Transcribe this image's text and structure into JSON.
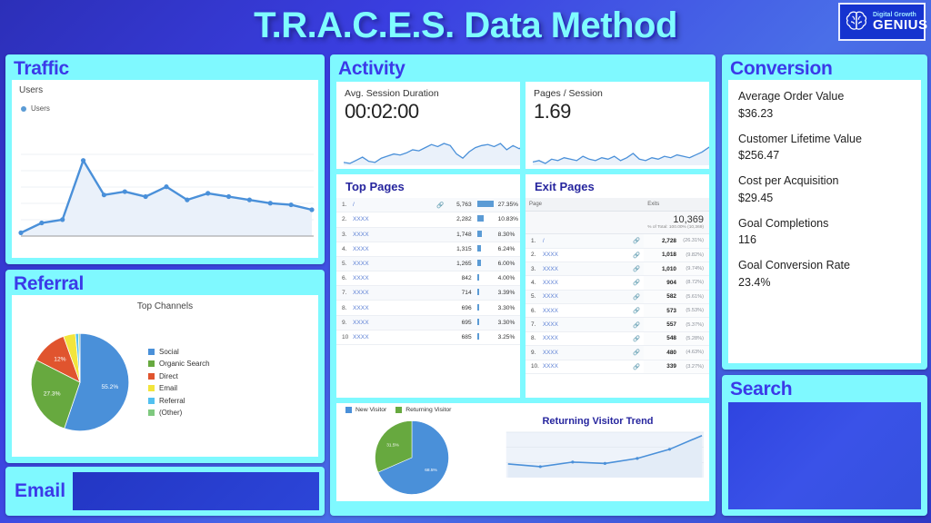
{
  "header": {
    "title": "T.R.A.C.E.S. Data Method",
    "logo": {
      "small": "Digital Growth",
      "big": "GENIUS",
      "icon": "brain-icon"
    }
  },
  "traffic": {
    "title": "Traffic",
    "chart_label": "Users",
    "legend": "Users",
    "chart_data": {
      "type": "line",
      "title": "Users",
      "xlabel": "",
      "ylabel": "Users",
      "legend": [
        "Users"
      ],
      "grid": true,
      "series": [
        {
          "name": "Users",
          "values": [
            2,
            8,
            10,
            46,
            25,
            27,
            24,
            30,
            22,
            26,
            24,
            22,
            20,
            19,
            16
          ]
        }
      ],
      "ylim": [
        0,
        50
      ]
    }
  },
  "referral": {
    "title": "Referral",
    "chart_data": {
      "type": "pie",
      "title": "Top Channels",
      "legend_position": "right",
      "categories": [
        "Social",
        "Organic Search",
        "Direct",
        "Email",
        "Referral",
        "(Other)"
      ],
      "values": [
        55.2,
        27.3,
        12.0,
        4.0,
        1.0,
        0.5
      ],
      "labels": [
        "55.2%",
        "27.3%",
        "12%",
        "",
        "",
        ""
      ],
      "colors": [
        "#4a90d9",
        "#67a93f",
        "#e0542e",
        "#f2e53c",
        "#52c0f0",
        "#7fc97f"
      ]
    }
  },
  "email": {
    "title": "Email"
  },
  "activity": {
    "title": "Activity",
    "kpis": [
      {
        "label": "Avg. Session Duration",
        "value": "00:02:00",
        "sparkline": "avg-session-duration-sparkline"
      },
      {
        "label": "Pages / Session",
        "value": "1.69",
        "sparkline": "pages-per-session-sparkline"
      }
    ],
    "top_pages": {
      "title": "Top Pages",
      "rows": [
        {
          "rank": "1.",
          "page": "/",
          "views": "5,763",
          "pct": "27.35%",
          "bar": 100
        },
        {
          "rank": "2.",
          "page": "XXXX",
          "views": "2,282",
          "pct": "10.83%",
          "bar": 40
        },
        {
          "rank": "3.",
          "page": "XXXX",
          "views": "1,748",
          "pct": "8.30%",
          "bar": 30
        },
        {
          "rank": "4.",
          "page": "XXXX",
          "views": "1,315",
          "pct": "6.24%",
          "bar": 23
        },
        {
          "rank": "5.",
          "page": "XXXX",
          "views": "1,265",
          "pct": "6.00%",
          "bar": 22
        },
        {
          "rank": "6.",
          "page": "XXXX",
          "views": "842",
          "pct": "4.00%",
          "bar": 15
        },
        {
          "rank": "7.",
          "page": "XXXX",
          "views": "714",
          "pct": "3.39%",
          "bar": 13
        },
        {
          "rank": "8.",
          "page": "XXXX",
          "views": "696",
          "pct": "3.30%",
          "bar": 12
        },
        {
          "rank": "9.",
          "page": "XXXX",
          "views": "695",
          "pct": "3.30%",
          "bar": 12
        },
        {
          "rank": "10",
          "page": "XXXX",
          "views": "685",
          "pct": "3.25%",
          "bar": 12
        }
      ]
    },
    "exit_pages": {
      "title": "Exit Pages",
      "col_page": "Page",
      "col_exits": "Exits",
      "total_value": "10,369",
      "total_sub": "% of Total: 100.00% (10,369)",
      "rows": [
        {
          "rank": "1.",
          "page": "/",
          "exits": "2,728",
          "pct": "(26.31%)"
        },
        {
          "rank": "2.",
          "page": "XXXX",
          "exits": "1,018",
          "pct": "(9.82%)"
        },
        {
          "rank": "3.",
          "page": "XXXX",
          "exits": "1,010",
          "pct": "(9.74%)"
        },
        {
          "rank": "4.",
          "page": "XXXX",
          "exits": "904",
          "pct": "(8.72%)"
        },
        {
          "rank": "5.",
          "page": "XXXX",
          "exits": "582",
          "pct": "(5.61%)"
        },
        {
          "rank": "6.",
          "page": "XXXX",
          "exits": "573",
          "pct": "(5.53%)"
        },
        {
          "rank": "7.",
          "page": "XXXX",
          "exits": "557",
          "pct": "(5.37%)"
        },
        {
          "rank": "8.",
          "page": "XXXX",
          "exits": "548",
          "pct": "(5.28%)"
        },
        {
          "rank": "9.",
          "page": "XXXX",
          "exits": "480",
          "pct": "(4.63%)"
        },
        {
          "rank": "10.",
          "page": "XXXX",
          "exits": "339",
          "pct": "(3.27%)"
        }
      ]
    },
    "visitors": {
      "legend": [
        "New Visitor",
        "Returning Visitor"
      ],
      "chart_data": {
        "type": "pie",
        "title": "",
        "categories": [
          "New Visitor",
          "Returning Visitor"
        ],
        "values": [
          68.5,
          31.5
        ],
        "labels": [
          "68.5%",
          "31.5%"
        ],
        "colors": [
          "#4a90d9",
          "#67a93f"
        ]
      },
      "trend": {
        "title": "Returning Visitor Trend",
        "chart_data": {
          "type": "area",
          "title": "Returning Visitor Trend",
          "x": [
            1,
            2,
            3,
            4,
            5,
            6,
            7
          ],
          "values": [
            30,
            24,
            34,
            31,
            42,
            62,
            92
          ],
          "ylim": [
            0,
            100
          ],
          "grid": true
        }
      }
    }
  },
  "conversion": {
    "title": "Conversion",
    "items": [
      {
        "key": "Average Order Value",
        "value": "$36.23"
      },
      {
        "key": "Customer Lifetime Value",
        "value": "$256.47"
      },
      {
        "key": "Cost per Acquisition",
        "value": "$29.45"
      },
      {
        "key": "Goal Completions",
        "value": "116"
      },
      {
        "key": "Goal Conversion Rate",
        "value": "23.4%"
      }
    ]
  },
  "search": {
    "title": "Search"
  },
  "colors": {
    "background": "#3a3ee0",
    "panel": "#7ff9ff",
    "title": "#3b3ae8",
    "accent_line": "#5b9bd5",
    "dark_blue": "#2336c4"
  }
}
